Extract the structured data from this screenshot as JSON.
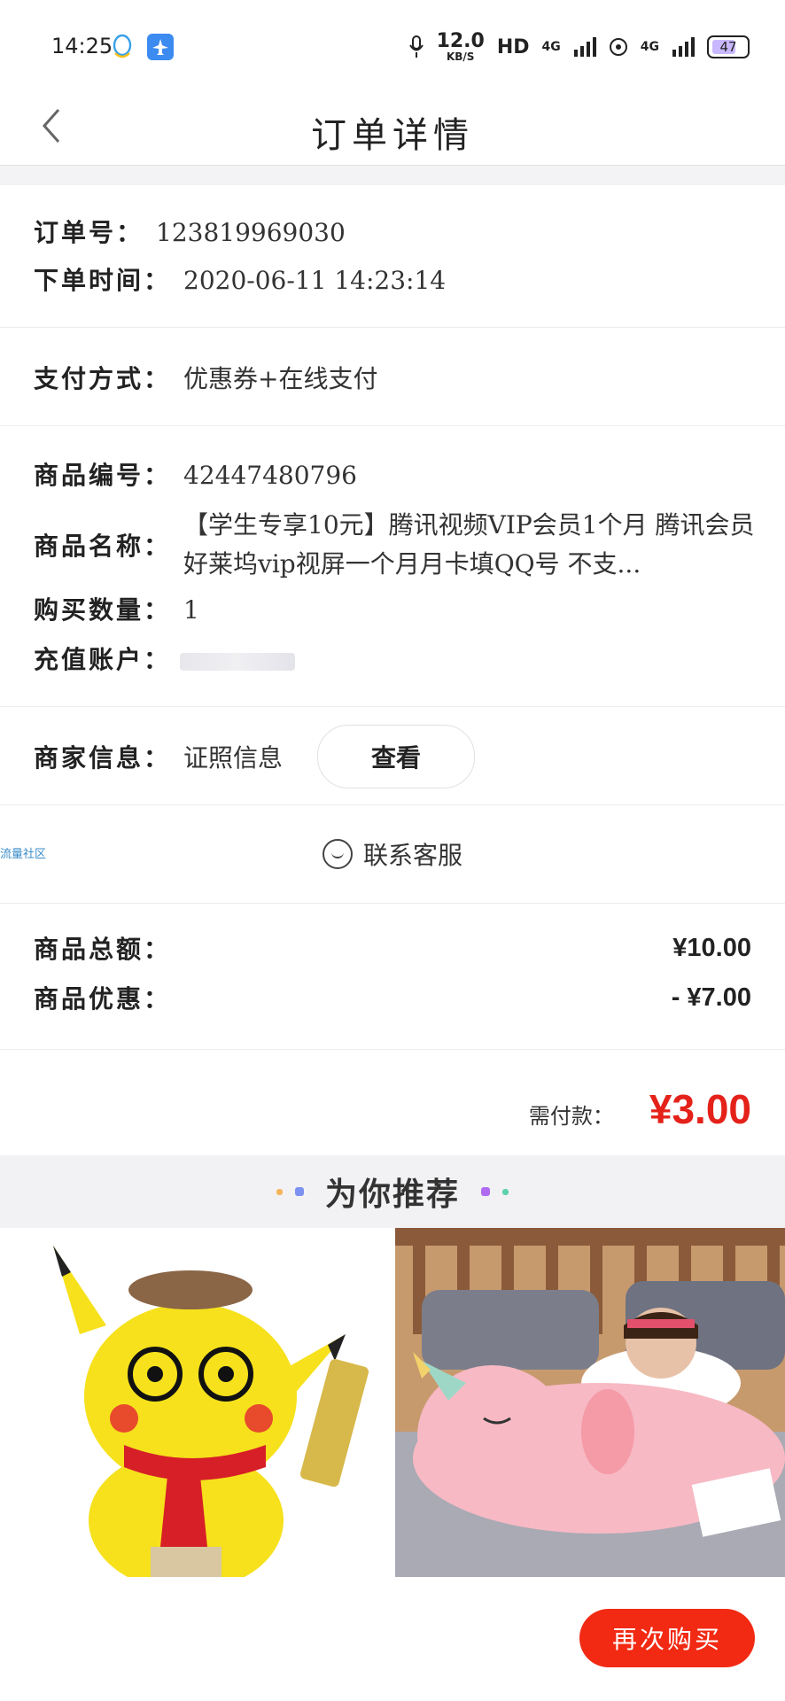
{
  "status_bar": {
    "time": "14:25",
    "speed_value": "12.0",
    "speed_unit": "KB/S",
    "hd": "HD",
    "net1": "4G",
    "net2": "4G",
    "battery": "47"
  },
  "nav": {
    "title": "订单详情"
  },
  "order": {
    "order_no_label": "订单号：",
    "order_no": "123819969030",
    "time_label": "下单时间：",
    "time": "2020-06-11 14:23:14"
  },
  "payment": {
    "label": "支付方式：",
    "value": "优惠券+在线支付"
  },
  "product": {
    "code_label": "商品编号：",
    "code": "42447480796",
    "name_label": "商品名称：",
    "name": "【学生专享10元】腾讯视频VIP会员1个月 腾讯会员好莱坞vip视屏一个月月卡填QQ号 不支...",
    "qty_label": "购买数量：",
    "qty": "1",
    "account_label": "充值账户："
  },
  "merchant": {
    "label": "商家信息：",
    "value": "证照信息",
    "view_button": "查看"
  },
  "contact": {
    "label": "联系客服",
    "watermark": "流量社区"
  },
  "amounts": {
    "total_label": "商品总额：",
    "total": "¥10.00",
    "discount_label": "商品优惠：",
    "discount": "- ¥7.00",
    "due_label": "需付款：",
    "due": "¥3.00"
  },
  "recommend": {
    "title": "为你推荐"
  },
  "colors": {
    "accent_red": "#e4221a",
    "button_red": "#f22a13"
  },
  "actions": {
    "buy_again": "再次购买"
  }
}
